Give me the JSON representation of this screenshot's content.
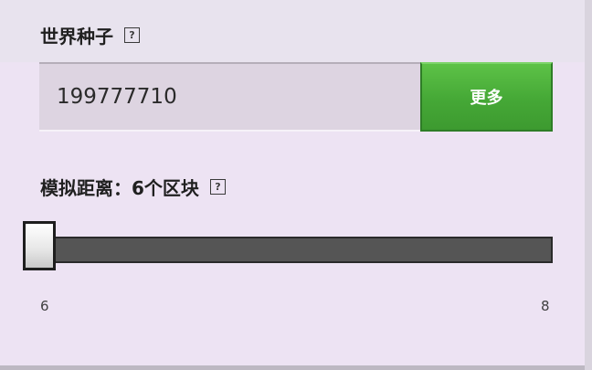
{
  "world_seed": {
    "label": "世界种子",
    "help_icon": "?",
    "value": "199777710",
    "more_button_label": "更多"
  },
  "simulation_distance": {
    "label": "模拟距离：6个区块",
    "help_icon": "?",
    "min_label": "6",
    "max_label": "8",
    "value": 6,
    "min": 6,
    "max": 8
  },
  "colors": {
    "accent_green": "#4caf3a",
    "background": "#ede3f3",
    "slider_track": "#555555"
  },
  "icons": {
    "help": "question-box-icon"
  }
}
